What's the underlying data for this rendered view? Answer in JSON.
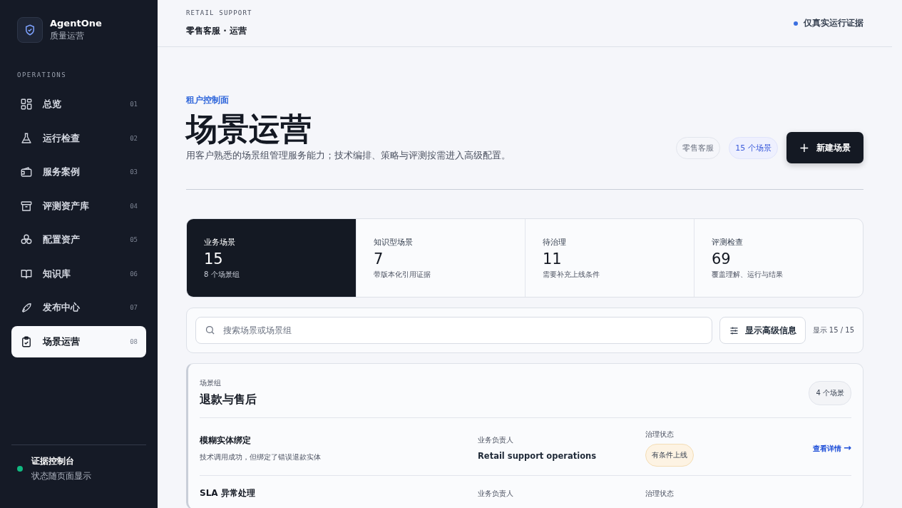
{
  "brand": {
    "name": "AgentOne",
    "subtitle": "质量运营"
  },
  "sidebar": {
    "section": "OPERATIONS",
    "items": [
      {
        "label": "总览",
        "number": "01",
        "selected": false
      },
      {
        "label": "运行检查",
        "number": "02",
        "selected": false
      },
      {
        "label": "服务案例",
        "number": "03",
        "selected": false
      },
      {
        "label": "评测资产库",
        "number": "04",
        "selected": false
      },
      {
        "label": "配置资产",
        "number": "05",
        "selected": false
      },
      {
        "label": "知识库",
        "number": "06",
        "selected": false
      },
      {
        "label": "发布中心",
        "number": "07",
        "selected": false
      },
      {
        "label": "场景运营",
        "number": "08",
        "selected": true
      }
    ],
    "footer": {
      "title": "证据控制台",
      "subtitle": "状态随页面显示",
      "color": "#10b981"
    }
  },
  "header": {
    "eyebrow": "RETAIL SUPPORT",
    "title": "零售客服 · 运营",
    "status": "仅真实运行证据"
  },
  "hero": {
    "eyebrow": "租户控制面",
    "title": "场景运营",
    "description": "用客户熟悉的场景组管理服务能力；技术编排、策略与评测按需进入高级配置。",
    "tags": [
      {
        "label": "零售客服",
        "kind": "plain"
      },
      {
        "label": "15 个场景",
        "kind": "accent"
      }
    ],
    "button": "新建场景",
    "button_icon": "+"
  },
  "stats": [
    {
      "label": "业务场景",
      "value": "15",
      "note": "8 个场景组",
      "selected": true
    },
    {
      "label": "知识型场景",
      "value": "7",
      "note": "带版本化引用证据",
      "selected": false
    },
    {
      "label": "待治理",
      "value": "11",
      "note": "需要补充上线条件",
      "selected": false
    },
    {
      "label": "评测检查",
      "value": "69",
      "note": "覆盖理解、运行与结果",
      "selected": false
    }
  ],
  "filter": {
    "placeholder": "搜索场景或场景组",
    "toggle": "显示高级信息",
    "count": "显示 15 / 15"
  },
  "group": {
    "eyebrow": "场景组",
    "title": "退款与售后",
    "count": "4 个场景",
    "rows": [
      {
        "name": "模糊实体绑定",
        "description": "技术调用成功，但绑定了错误退款实体",
        "owner_label": "业务负责人",
        "owner": "Retail support operations",
        "status_label": "治理状态",
        "status": "有条件上线",
        "link": "查看详情",
        "link_icon": "→"
      },
      {
        "name": "SLA 异常处理",
        "owner_label": "业务负责人",
        "status_label": "治理状态"
      }
    ]
  }
}
